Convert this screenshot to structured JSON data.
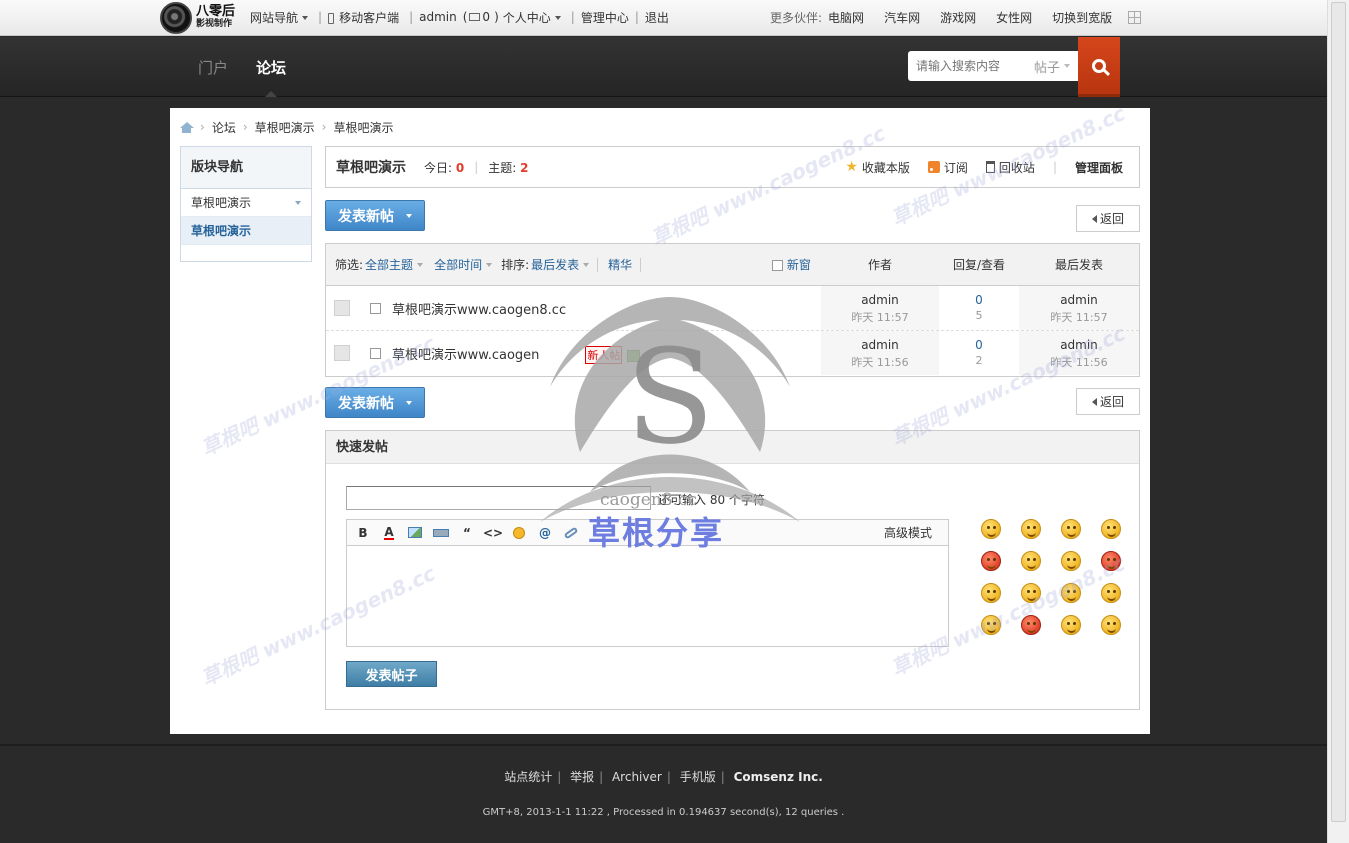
{
  "topbar": {
    "logo_line1": "八零后",
    "logo_line2": "影视制作",
    "site_nav": "网站导航",
    "mobile": "移动客户端",
    "user": "admin",
    "mail_open": "(",
    "mail_count": "0",
    "mail_close": ")",
    "personal": "个人中心",
    "manage": "管理中心",
    "logout": "退出",
    "partners_label": "更多伙伴:",
    "partners": [
      "电脑网",
      "汽车网",
      "游戏网",
      "女性网",
      "切换到宽版"
    ]
  },
  "header": {
    "nav": [
      "门户",
      "论坛"
    ],
    "search_placeholder": "请输入搜索内容",
    "search_type": "帖子"
  },
  "breadcrumb": [
    "论坛",
    "草根吧演示",
    "草根吧演示"
  ],
  "sidenav": {
    "title": "版块导航",
    "group": "草根吧演示",
    "item": "草根吧演示"
  },
  "forum": {
    "name": "草根吧演示",
    "today_label": "今日:",
    "today": "0",
    "topics_label": "主题:",
    "topics": "2",
    "favorite": "收藏本版",
    "subscribe": "订阅",
    "recycle": "回收站",
    "admin_panel": "管理面板"
  },
  "buttons": {
    "new_post": "发表新帖",
    "back": "返回",
    "submit": "发表帖子"
  },
  "filter": {
    "label": "筛选:",
    "all_topics": "全部主题",
    "all_time": "全部时间",
    "sort_label": "排序:",
    "sort": "最后发表",
    "digest": "精华",
    "new_window": "新窗",
    "col_author": "作者",
    "col_replies": "回复/查看",
    "col_last": "最后发表"
  },
  "threads": [
    {
      "title": "草根吧演示www.caogen8.cc",
      "tag": "",
      "author": "admin",
      "date": "昨天 11:57",
      "replies": "0",
      "views": "5",
      "last_user": "admin",
      "last_date": "昨天 11:57"
    },
    {
      "title": "草根吧演示www.caogen",
      "tag": "新人帖",
      "author": "admin",
      "date": "昨天 11:56",
      "replies": "0",
      "views": "2",
      "last_user": "admin",
      "last_date": "昨天 11:56"
    }
  ],
  "quick": {
    "title": "快速发帖",
    "limit": "还可输入 80 个字符",
    "advanced": "高级模式"
  },
  "footer": {
    "links": [
      "站点统计",
      "举报",
      "Archiver",
      "手机版"
    ],
    "company": "Comsenz Inc.",
    "note": "GMT+8, 2013-1-1 11:22 , Processed in 0.194637 second(s), 12 queries ."
  },
  "watermark": {
    "site": "caogen8.cc",
    "brand": "草根分享",
    "tile_text": "草根吧 www.caogen8.cc"
  },
  "colors": {
    "accent_blue": "#3f86c8",
    "search_orange": "#c83e16",
    "number_red": "#e23b2a",
    "link_blue": "#26639a"
  }
}
